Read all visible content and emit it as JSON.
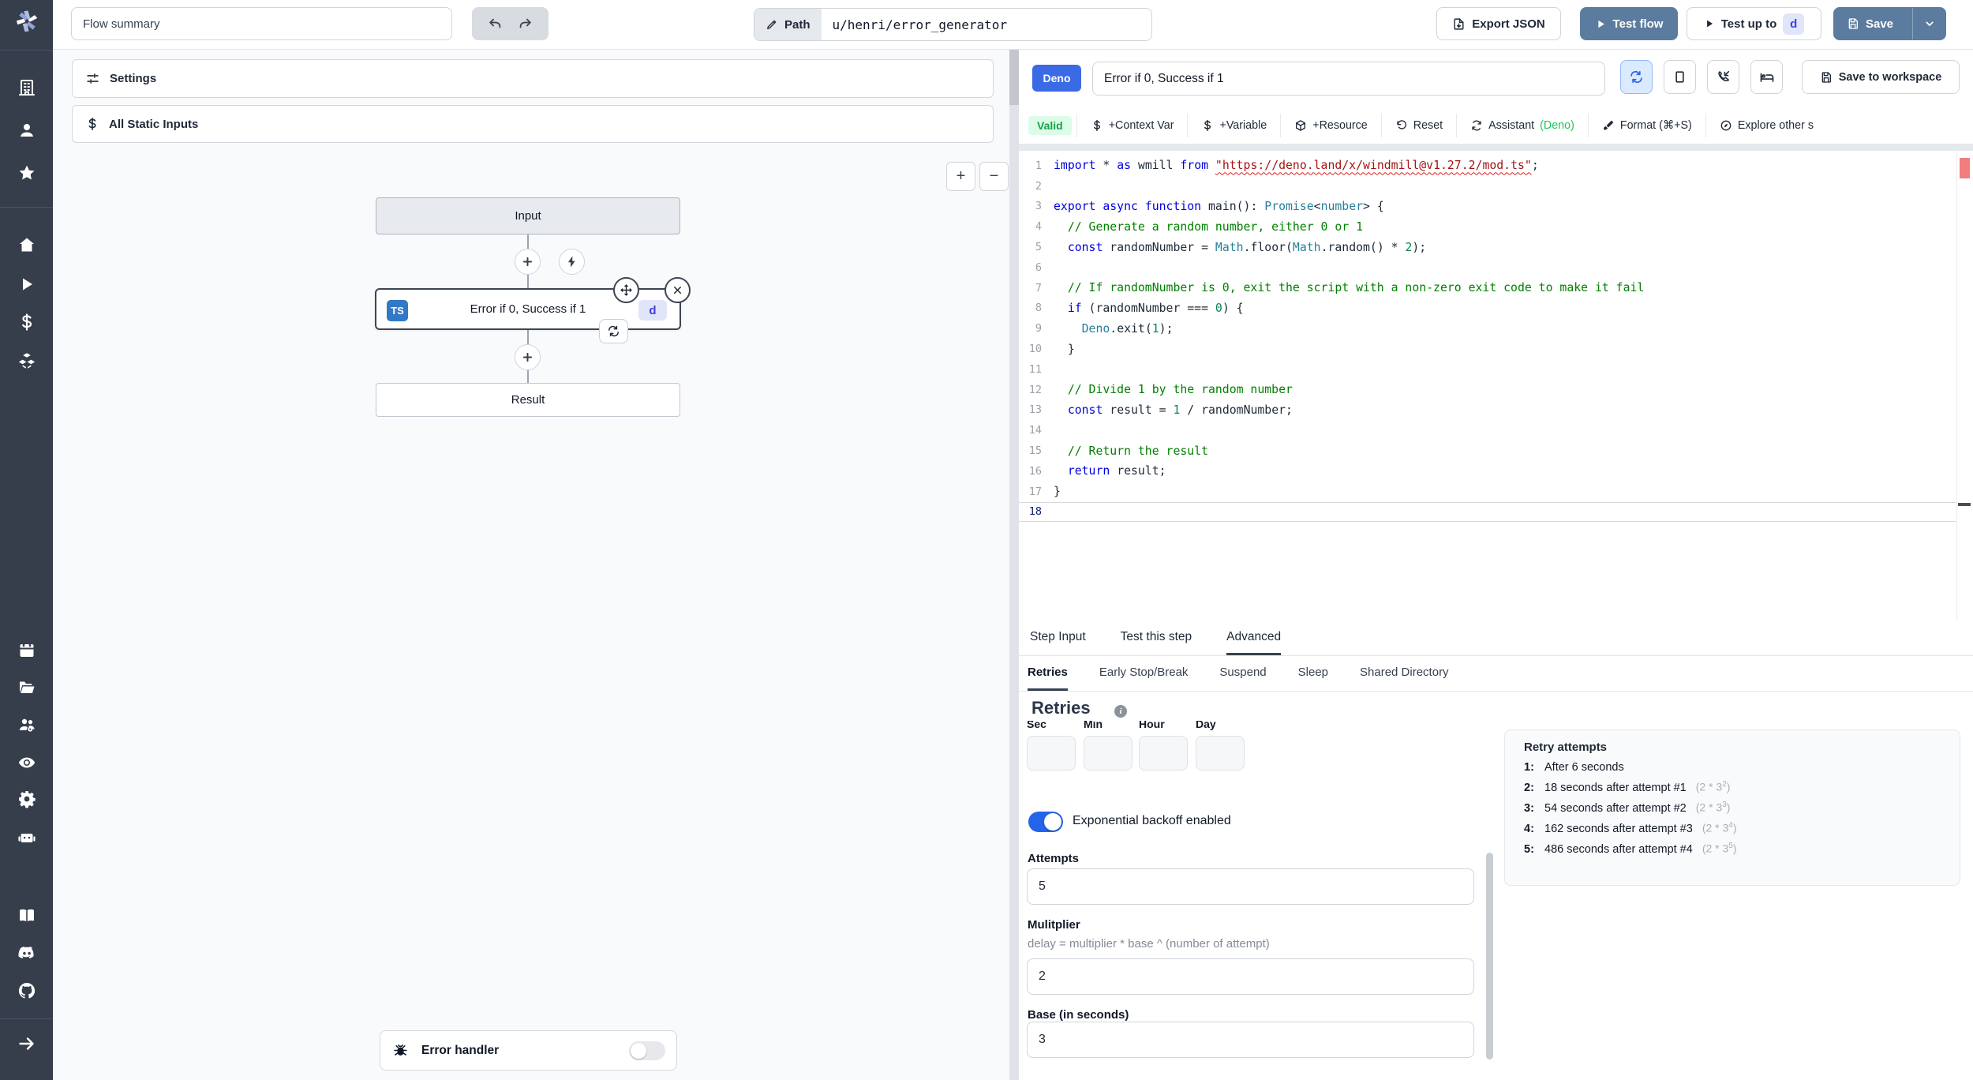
{
  "topbar": {
    "flow_summary_value": "Flow summary",
    "path_label": "Path",
    "path_value": "u/henri/error_generator",
    "export_json_label": "Export JSON",
    "test_flow_label": "Test flow",
    "test_up_to_label": "Test up to",
    "test_up_to_step": "d",
    "save_label": "Save"
  },
  "sidebar": {
    "icons": [
      "building",
      "user",
      "star",
      "home",
      "play",
      "dollar",
      "cubes",
      "calendar",
      "folder",
      "groups",
      "eye",
      "gear",
      "robot",
      "book",
      "discord",
      "github"
    ],
    "expand_icon": "arrow-right"
  },
  "left_panel": {
    "settings_label": "Settings",
    "static_inputs_label": "All Static Inputs",
    "zoom_in": "+",
    "zoom_out": "−",
    "flow": {
      "input_node": "Input",
      "step_lang_badge": "TS",
      "step_label": "Error if 0, Success if 1",
      "step_id_badge": "d",
      "result_node": "Result"
    },
    "error_handler_label": "Error handler"
  },
  "editor_panel": {
    "lang_badge": "Deno",
    "step_name": "Error if 0, Success if 1",
    "save_to_workspace_label": "Save to workspace",
    "valid_label": "Valid",
    "toolbar": [
      {
        "icon": "dollar",
        "label": "+Context Var"
      },
      {
        "icon": "dollar",
        "label": "+Variable"
      },
      {
        "icon": "box",
        "label": "+Resource"
      },
      {
        "icon": "rotate-ccw",
        "label": "Reset"
      },
      {
        "icon": "sync",
        "label": "Assistant ",
        "suffix": "(Deno)"
      },
      {
        "icon": "brush",
        "label": "Format (⌘+S)"
      },
      {
        "icon": "compass",
        "label": "Explore other s"
      }
    ],
    "code_lines": [
      {
        "n": 1,
        "toks": [
          {
            "c": "k",
            "t": "import "
          },
          {
            "c": "p",
            "t": "* "
          },
          {
            "c": "k",
            "t": "as "
          },
          {
            "c": "p",
            "t": "wmill "
          },
          {
            "c": "k",
            "t": "from "
          },
          {
            "c": "s sq",
            "t": "\"https://deno.land/x/windmill@v1.27.2/mod.ts\""
          },
          {
            "c": "p",
            "t": ";"
          }
        ]
      },
      {
        "n": 2,
        "toks": []
      },
      {
        "n": 3,
        "toks": [
          {
            "c": "k",
            "t": "export "
          },
          {
            "c": "k",
            "t": "async "
          },
          {
            "c": "k",
            "t": "function "
          },
          {
            "c": "p",
            "t": "main"
          },
          {
            "c": "p",
            "t": "(): "
          },
          {
            "c": "t",
            "t": "Promise"
          },
          {
            "c": "p",
            "t": "<"
          },
          {
            "c": "t",
            "t": "number"
          },
          {
            "c": "p",
            "t": "> {"
          }
        ]
      },
      {
        "n": 4,
        "toks": [
          {
            "c": "c",
            "t": "  // Generate a random number, either 0 or 1"
          }
        ]
      },
      {
        "n": 5,
        "toks": [
          {
            "c": "k",
            "t": "  const "
          },
          {
            "c": "p",
            "t": "randomNumber = "
          },
          {
            "c": "t",
            "t": "Math"
          },
          {
            "c": "p",
            "t": ".floor("
          },
          {
            "c": "t",
            "t": "Math"
          },
          {
            "c": "p",
            "t": ".random() * "
          },
          {
            "c": "n",
            "t": "2"
          },
          {
            "c": "p",
            "t": ");"
          }
        ]
      },
      {
        "n": 6,
        "toks": []
      },
      {
        "n": 7,
        "toks": [
          {
            "c": "c",
            "t": "  // If randomNumber is 0, exit the script with a non-zero exit code to make it fail"
          }
        ]
      },
      {
        "n": 8,
        "toks": [
          {
            "c": "k",
            "t": "  if "
          },
          {
            "c": "p",
            "t": "(randomNumber === "
          },
          {
            "c": "n",
            "t": "0"
          },
          {
            "c": "p",
            "t": ") {"
          }
        ]
      },
      {
        "n": 9,
        "toks": [
          {
            "c": "p",
            "t": "    "
          },
          {
            "c": "t",
            "t": "Deno"
          },
          {
            "c": "p",
            "t": ".exit("
          },
          {
            "c": "n",
            "t": "1"
          },
          {
            "c": "p",
            "t": ");"
          }
        ]
      },
      {
        "n": 10,
        "toks": [
          {
            "c": "p",
            "t": "  }"
          }
        ]
      },
      {
        "n": 11,
        "toks": []
      },
      {
        "n": 12,
        "toks": [
          {
            "c": "c",
            "t": "  // Divide 1 by the random number"
          }
        ]
      },
      {
        "n": 13,
        "toks": [
          {
            "c": "k",
            "t": "  const "
          },
          {
            "c": "p",
            "t": "result = "
          },
          {
            "c": "n",
            "t": "1"
          },
          {
            "c": "p",
            "t": " / randomNumber;"
          }
        ]
      },
      {
        "n": 14,
        "toks": []
      },
      {
        "n": 15,
        "toks": [
          {
            "c": "c",
            "t": "  // Return the result"
          }
        ]
      },
      {
        "n": 16,
        "toks": [
          {
            "c": "k",
            "t": "  return "
          },
          {
            "c": "p",
            "t": "result;"
          }
        ]
      },
      {
        "n": 17,
        "toks": [
          {
            "c": "p",
            "t": "}"
          }
        ]
      },
      {
        "n": 18,
        "toks": [],
        "current": true
      }
    ]
  },
  "bottom_panel": {
    "tabs": [
      "Step Input",
      "Test this step",
      "Advanced"
    ],
    "active_tab": "Advanced",
    "subtabs": [
      "Retries",
      "Early Stop/Break",
      "Suspend",
      "Sleep",
      "Shared Directory"
    ],
    "active_subtab": "Retries",
    "retries": {
      "title": "Retries",
      "time_units": [
        "Sec",
        "Min",
        "Hour",
        "Day"
      ],
      "backoff_label": "Exponential backoff enabled",
      "backoff_enabled": true,
      "attempts_label": "Attempts",
      "attempts_value": "5",
      "multiplier_label": "Mulitplier",
      "multiplier_help": "delay = multiplier * base ^ (number of attempt)",
      "multiplier_value": "2",
      "base_label": "Base (in seconds)",
      "base_value": "3"
    },
    "retry_attempts": {
      "title": "Retry attempts",
      "rows": [
        {
          "n": "1:",
          "text": "After 6 seconds",
          "formula_base": "",
          "formula_exp": ""
        },
        {
          "n": "2:",
          "text": "18 seconds after attempt #1",
          "formula_base": "(2 * 3",
          "formula_exp": "2"
        },
        {
          "n": "3:",
          "text": "54 seconds after attempt #2",
          "formula_base": "(2 * 3",
          "formula_exp": "3"
        },
        {
          "n": "4:",
          "text": "162 seconds after attempt #3",
          "formula_base": "(2 * 3",
          "formula_exp": "4"
        },
        {
          "n": "5:",
          "text": "486 seconds after attempt #4",
          "formula_base": "(2 * 3",
          "formula_exp": "5"
        }
      ]
    }
  }
}
